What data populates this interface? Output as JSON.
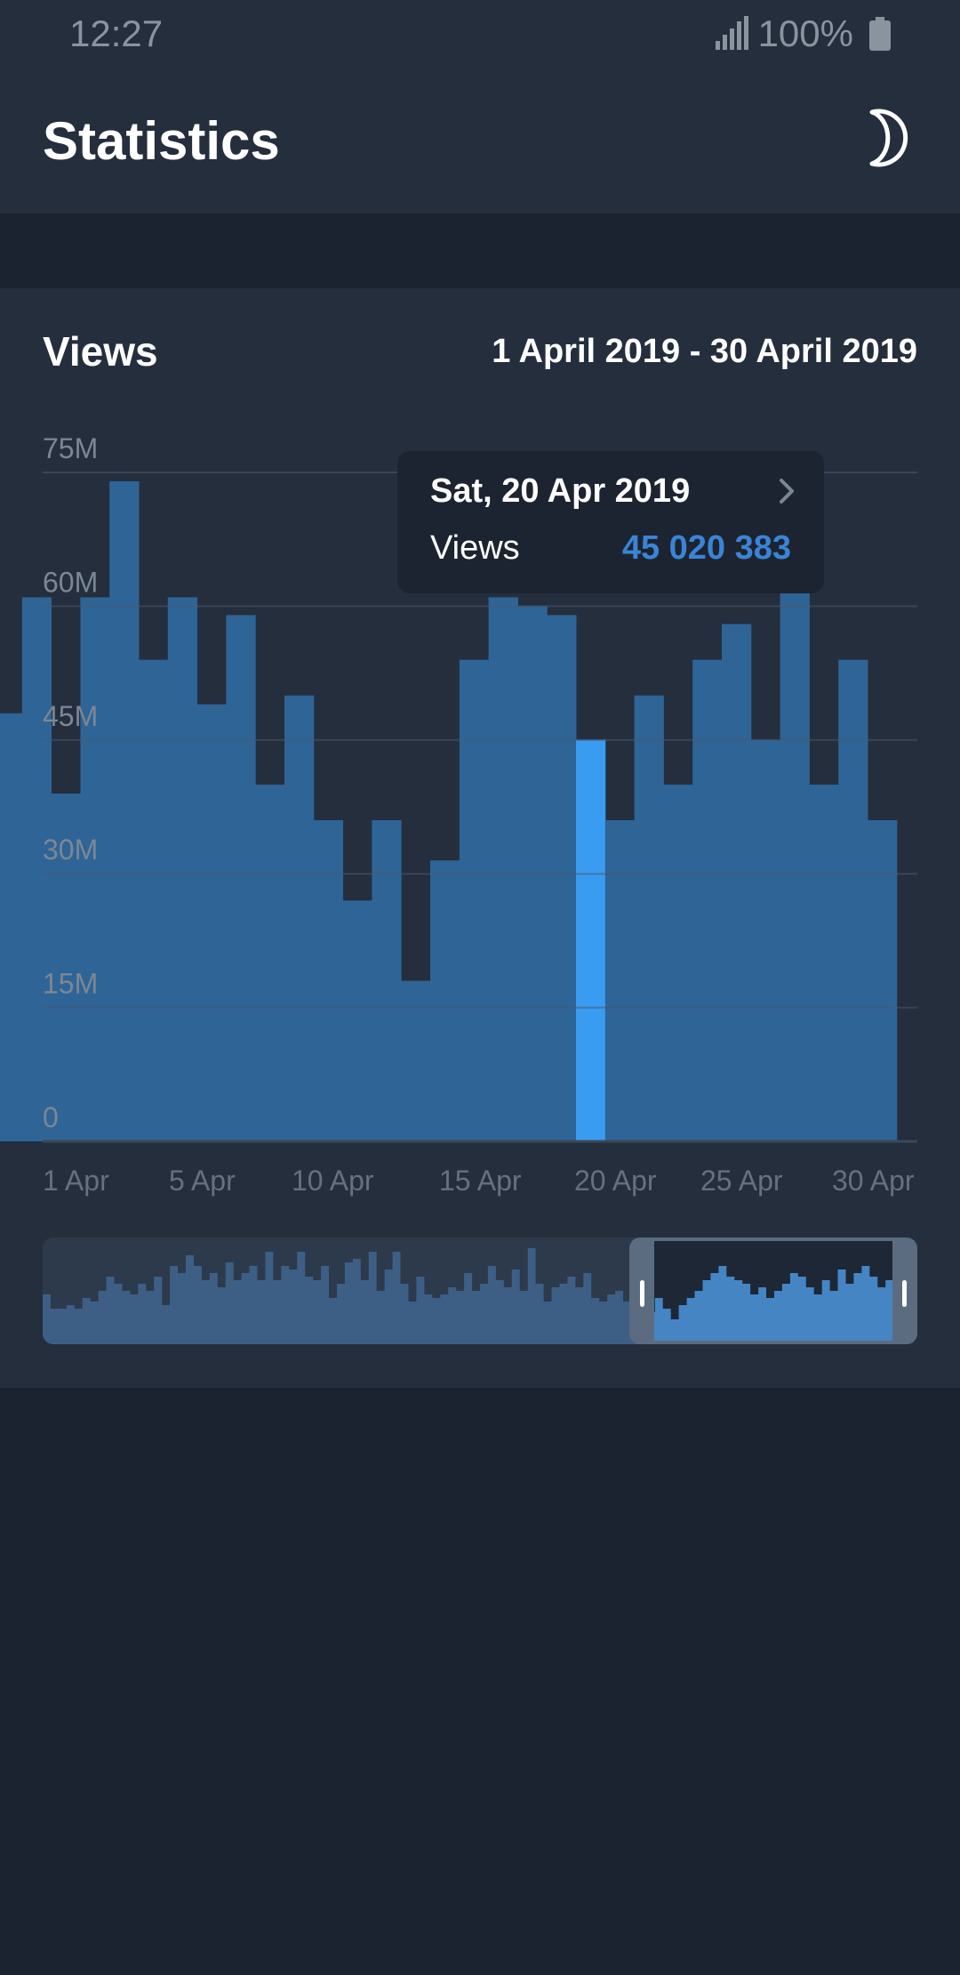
{
  "status_bar": {
    "time": "12:27",
    "battery": "100%",
    "icons": [
      "signal-icon",
      "battery-icon"
    ]
  },
  "header": {
    "title": "Statistics",
    "theme_toggle_icon": "moon-icon"
  },
  "card": {
    "title": "Views",
    "date_range": "1 April 2019 - 30 April 2019"
  },
  "tooltip": {
    "date": "Sat, 20 Apr 2019",
    "label": "Views",
    "value": "45 020 383",
    "chevron_icon": "chevron-right-icon"
  },
  "colors": {
    "bar": "#2f6496",
    "bar_selected": "#3a9cf0",
    "value_accent": "#3b84d5",
    "background": "#242e3d"
  },
  "chart_data": {
    "type": "bar",
    "title": "Views",
    "x_tick_labels": [
      "1 Apr",
      "5 Apr",
      "10 Apr",
      "15 Apr",
      "20 Apr",
      "25 Apr",
      "30 Apr"
    ],
    "y_tick_labels": [
      "0",
      "15M",
      "30M",
      "45M",
      "60M",
      "75M"
    ],
    "ylim": [
      0,
      75000000
    ],
    "grid": true,
    "selected_index": 20,
    "series": [
      {
        "values": [
          48000000,
          61000000,
          39000000,
          61000000,
          74000000,
          54000000,
          61000000,
          49000000,
          59000000,
          40000000,
          50000000,
          36000000,
          27000000,
          36000000,
          18000000,
          31500000,
          54000000,
          61000000,
          60000000,
          59000000,
          45020383,
          36000000,
          50000000,
          40000000,
          54000000,
          58000000,
          45000000,
          72000000,
          40000000,
          54000000,
          36000000
        ]
      }
    ]
  },
  "navigator_data": {
    "values": [
      14,
      10,
      10,
      11,
      10,
      13,
      12,
      15,
      19,
      17,
      15,
      14,
      17,
      15,
      19,
      11,
      22,
      20,
      25,
      22,
      18,
      20,
      16,
      23,
      18,
      20,
      22,
      18,
      26,
      18,
      22,
      21,
      26,
      19,
      18,
      22,
      13,
      17,
      23,
      24,
      18,
      26,
      15,
      21,
      26,
      17,
      12,
      19,
      14,
      13,
      14,
      16,
      15,
      20,
      15,
      17,
      22,
      18,
      16,
      21,
      15,
      27,
      17,
      12,
      16,
      17,
      19,
      16,
      20,
      13,
      12,
      14,
      15,
      12,
      16,
      13,
      9,
      13,
      10,
      7,
      11,
      13,
      15,
      18,
      20,
      22,
      19,
      18,
      17,
      14,
      16,
      13,
      15,
      17,
      20,
      19,
      16,
      14,
      18,
      15,
      21,
      17,
      20,
      22,
      19,
      16,
      18,
      15,
      21,
      13
    ]
  }
}
